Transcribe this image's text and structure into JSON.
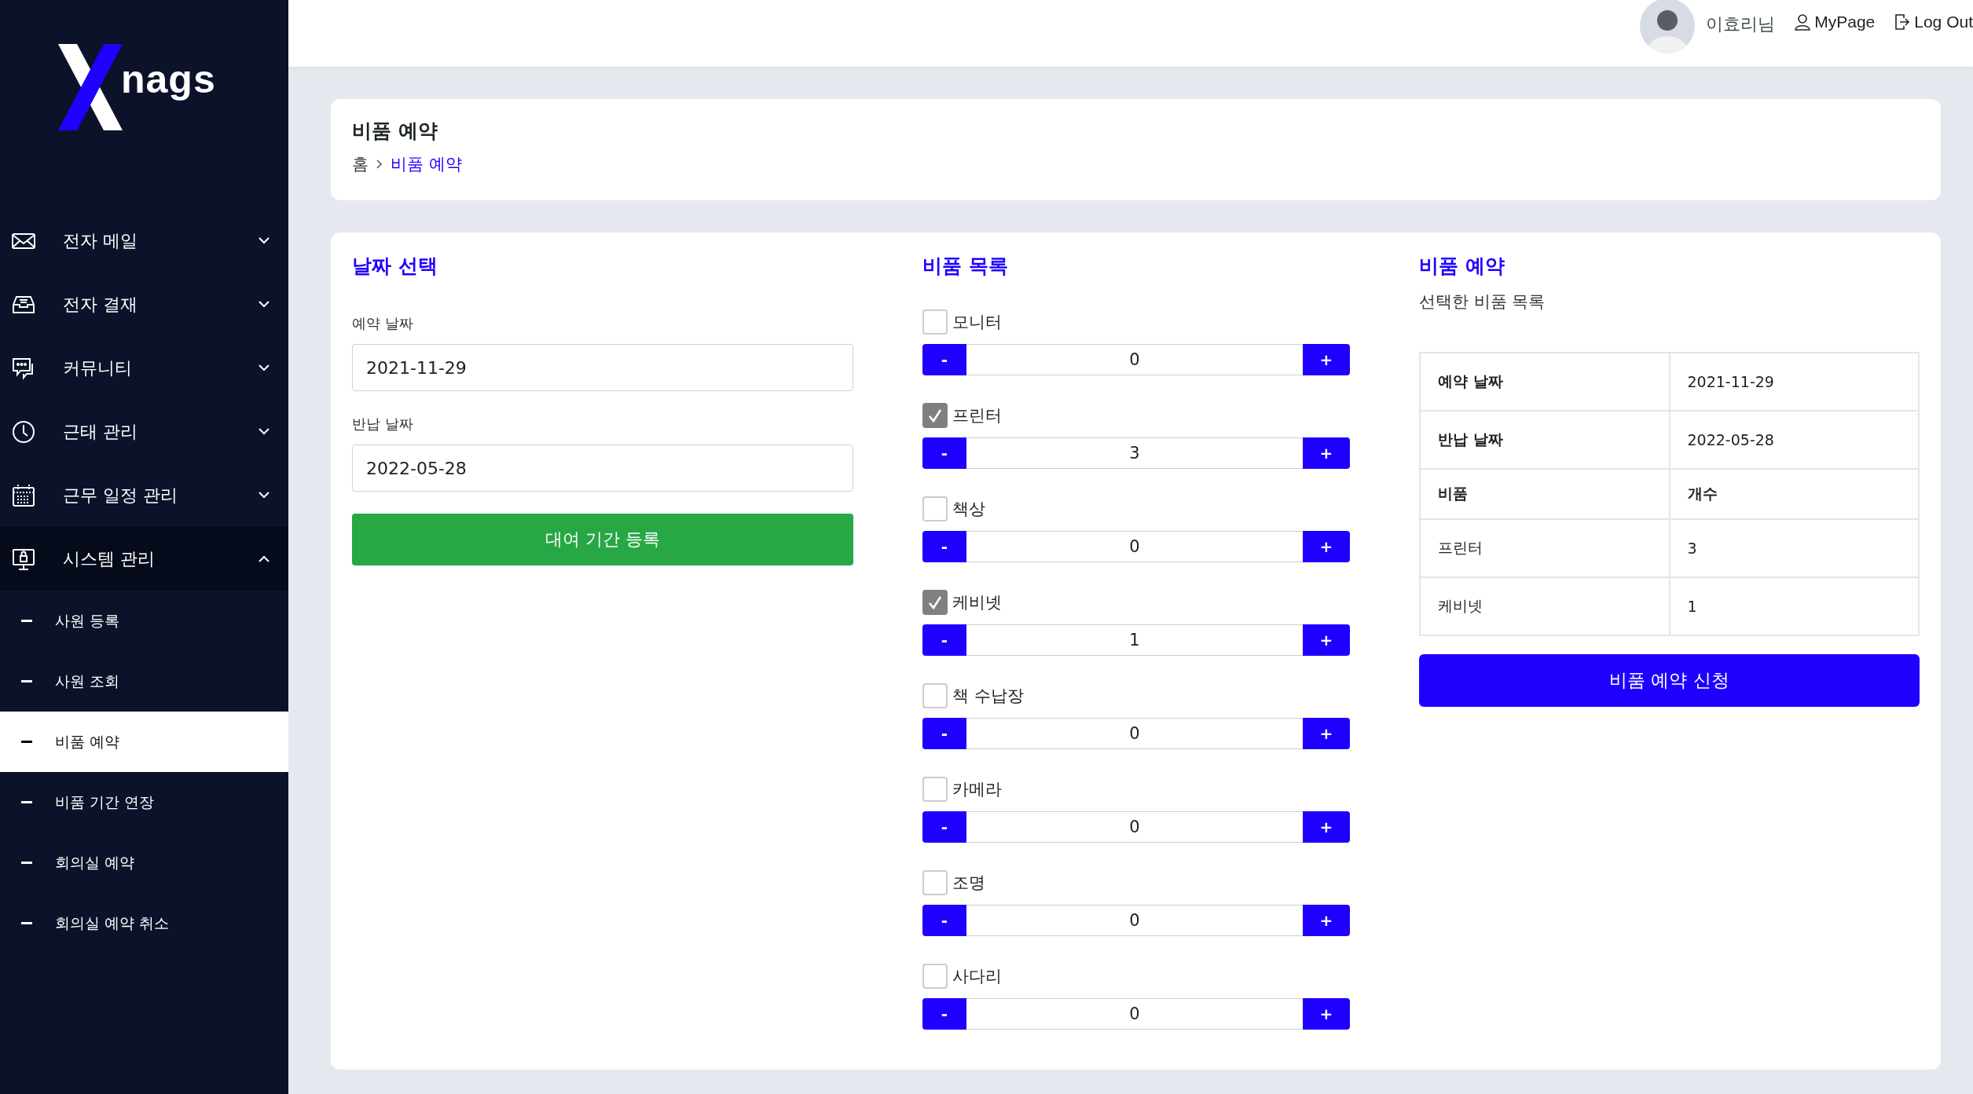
{
  "sidebar": {
    "logo_text": "nags",
    "menu": [
      {
        "label": "전자 메일",
        "expanded": false
      },
      {
        "label": "전자 결재",
        "expanded": false
      },
      {
        "label": "커뮤니티",
        "expanded": false
      },
      {
        "label": "근태 관리",
        "expanded": false
      },
      {
        "label": "근무 일정 관리",
        "expanded": false
      },
      {
        "label": "시스템 관리",
        "expanded": true,
        "children": [
          {
            "label": "사원 등록",
            "selected": false
          },
          {
            "label": "사원 조회",
            "selected": false
          },
          {
            "label": "비품 예약",
            "selected": true
          },
          {
            "label": "비품 기간 연장",
            "selected": false
          },
          {
            "label": "회의실 예약",
            "selected": false
          },
          {
            "label": "회의실 예약 취소",
            "selected": false
          }
        ]
      }
    ]
  },
  "header": {
    "user_name": "이효리님",
    "links": [
      "MyPage",
      "Log Out"
    ]
  },
  "page_header": {
    "title": "비품 예약",
    "breadcrumb": [
      {
        "label": "홈",
        "selected": false
      },
      {
        "label": "비품 예약",
        "selected": true
      }
    ]
  },
  "date_panel": {
    "title": "날짜 선택",
    "fields": [
      {
        "label": "예약 날짜",
        "value": "2021-11-29"
      },
      {
        "label": "반납 날짜",
        "value": "2022-05-28"
      }
    ],
    "button": "대여 기간 등록"
  },
  "items_panel": {
    "title": "비품 목록",
    "items": [
      {
        "label": "모니터",
        "checked": false,
        "quantity": "0",
        "decrement": "-",
        "increment": "+"
      },
      {
        "label": "프린터",
        "checked": true,
        "quantity": "3",
        "decrement": "-",
        "increment": "+"
      },
      {
        "label": "책상",
        "checked": false,
        "quantity": "0",
        "decrement": "-",
        "increment": "+"
      },
      {
        "label": "케비넷",
        "checked": true,
        "quantity": "1",
        "decrement": "-",
        "increment": "+"
      },
      {
        "label": "책 수납장",
        "checked": false,
        "quantity": "0",
        "decrement": "-",
        "increment": "+"
      },
      {
        "label": "카메라",
        "checked": false,
        "quantity": "0",
        "decrement": "-",
        "increment": "+"
      },
      {
        "label": "조명",
        "checked": false,
        "quantity": "0",
        "decrement": "-",
        "increment": "+"
      },
      {
        "label": "사다리",
        "checked": false,
        "quantity": "0",
        "decrement": "-",
        "increment": "+"
      }
    ]
  },
  "reservation_panel": {
    "title": "비품 예약",
    "subtitle": "선택한 비품 목록",
    "rows": [
      {
        "kind": "field",
        "cells": [
          "예약 날짜",
          "2021-11-29"
        ]
      },
      {
        "kind": "field",
        "cells": [
          "반납 날짜",
          "2022-05-28"
        ]
      },
      {
        "kind": "header",
        "cells": [
          "비품",
          "개수"
        ]
      },
      {
        "kind": "item",
        "cells": [
          "프린터",
          "3"
        ]
      },
      {
        "kind": "item",
        "cells": [
          "케비넷",
          "1"
        ]
      }
    ],
    "button": "비품 예약 신청"
  }
}
